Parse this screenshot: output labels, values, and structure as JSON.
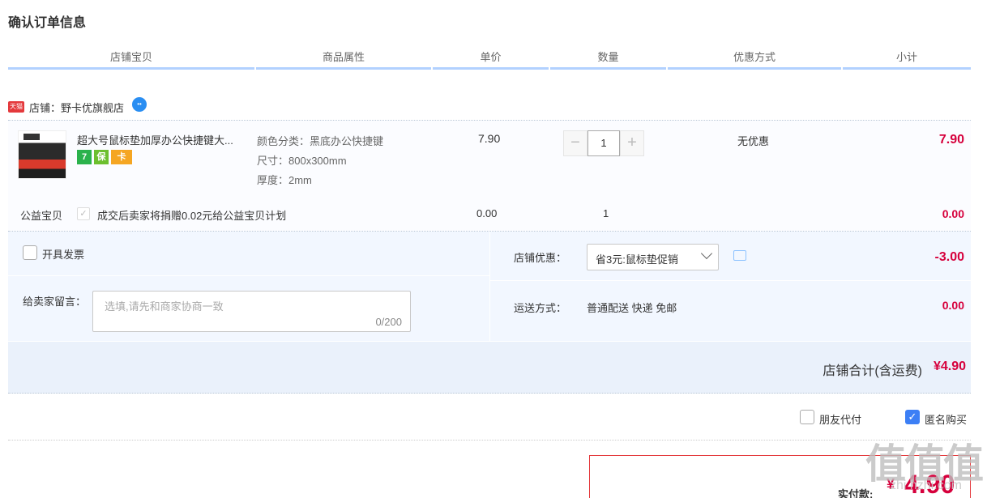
{
  "page": {
    "title": "确认订单信息"
  },
  "table_headers": [
    "店铺宝贝",
    "商品属性",
    "单价",
    "数量",
    "优惠方式",
    "小计"
  ],
  "shop": {
    "tmall_badge": "天猫",
    "label": "店铺：野卡优旗舰店",
    "icon": "wangwang-chat-icon"
  },
  "item": {
    "name": "超大号鼠标垫加厚办公快捷键大...",
    "badges": [
      "7",
      "保",
      "卡"
    ],
    "attrs": [
      "颜色分类：黑底办公快捷键",
      "尺寸：800x300mm",
      "厚度：2mm"
    ],
    "price": "7.90",
    "quantity": "1",
    "qty_minus": "−",
    "qty_plus": "+",
    "promotion": "无优惠",
    "subtotal": "7.90"
  },
  "charity": {
    "label": "公益宝贝",
    "check": "✓",
    "text": "成交后卖家将捐赠0.02元给公益宝贝计划",
    "price": "0.00",
    "quantity": "1",
    "subtotal": "0.00"
  },
  "options": {
    "invoice_label": "开具发票",
    "message_label": "给卖家留言：",
    "message_placeholder": "选填,请先和商家协商一致",
    "message_count": "0/200",
    "shop_discount_label": "店铺优惠：",
    "shop_discount_value": "省3元:鼠标垫促销",
    "shop_discount_amount": "-3.00",
    "shipping_label": "运送方式：",
    "shipping_value": "普通配送 快递 免邮",
    "shipping_amount": "0.00"
  },
  "total": {
    "label": "店铺合计(含运费)",
    "amount": "¥4.90"
  },
  "extras": {
    "friend_pay": "朋友代付",
    "anonymous": "匿名购买",
    "anonymous_checked": true,
    "check_mark": "✓"
  },
  "payment": {
    "label": "实付款:",
    "currency": "¥",
    "amount": "4.90"
  },
  "watermark": {
    "main": "值值值",
    "sub": "zhi hzhi.com"
  },
  "colors": {
    "accent_red": "#d6003c",
    "header_line": "#b2d1ff",
    "option_bg": "#f2f7ff",
    "checkbox_blue": "#3c7ff5"
  }
}
